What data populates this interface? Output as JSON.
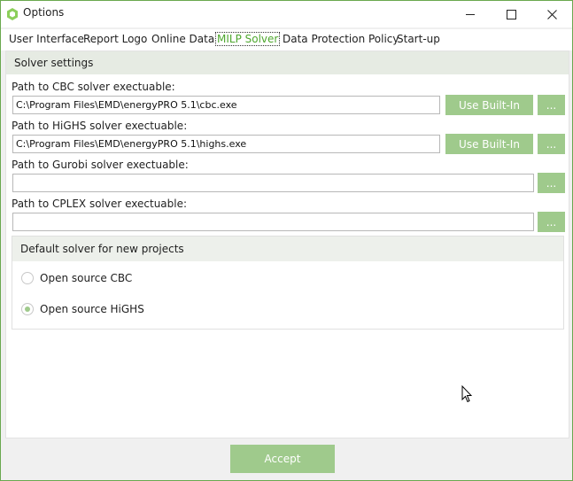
{
  "window": {
    "title": "Options"
  },
  "tabs": [
    "User Interface",
    "Report Logo",
    "Online Data",
    "MILP Solver",
    "Data Protection Policy",
    "Start-up"
  ],
  "active_tab": "MILP Solver",
  "solver_settings": {
    "header": "Solver settings",
    "cbc": {
      "label": "Path to CBC solver exectuable:",
      "value": "C:\\Program Files\\EMD\\energyPRO 5.1\\cbc.exe",
      "builtin_label": "Use Built-In",
      "browse_label": "..."
    },
    "highs": {
      "label": "Path to HiGHS solver exectuable:",
      "value": "C:\\Program Files\\EMD\\energyPRO 5.1\\highs.exe",
      "builtin_label": "Use Built-In",
      "browse_label": "..."
    },
    "gurobi": {
      "label": "Path to Gurobi solver exectuable:",
      "value": "",
      "browse_label": "..."
    },
    "cplex": {
      "label": "Path to CPLEX solver exectuable:",
      "value": "",
      "browse_label": "..."
    }
  },
  "default_solver": {
    "header": "Default solver for new projects",
    "options": [
      {
        "label": "Open source CBC",
        "checked": false
      },
      {
        "label": "Open source HiGHS",
        "checked": true
      }
    ]
  },
  "footer": {
    "accept_label": "Accept"
  },
  "colors": {
    "accent": "#4ea72e",
    "button": "#9fca8c",
    "header_bg": "#e6ebe3"
  }
}
